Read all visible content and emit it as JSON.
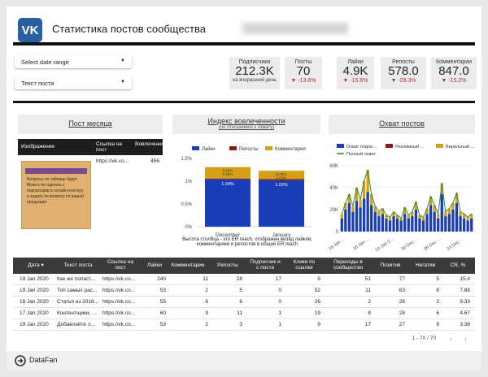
{
  "header": {
    "logo_text": "VK",
    "title": "Статистика постов сообщества"
  },
  "filters": {
    "date_range": "Select date range",
    "post_text": "Текст поста"
  },
  "kpis": [
    {
      "label": "Подписчики",
      "value": "212.3K",
      "sub": "на вчерашний день",
      "change": ""
    },
    {
      "label": "Посты",
      "value": "70",
      "sub": "",
      "change": "-13.6%"
    },
    {
      "label": "Лайки",
      "value": "4.9K",
      "sub": "",
      "change": "-15.6%"
    },
    {
      "label": "Репосты",
      "value": "578.0",
      "sub": "",
      "change": "-29.3%"
    },
    {
      "label": "Комментарии",
      "value": "847.0",
      "sub": "",
      "change": "-15.2%"
    }
  ],
  "sections": {
    "post_month": "Пост месяца",
    "engagement": "Индекс вовлеченности",
    "engagement_sub": "(по отношению к охвату)",
    "reach": "Охват постов"
  },
  "post_table": {
    "headers": [
      "Изображение",
      "Ссылка на пост",
      "Вовлеченность"
    ],
    "link": "https://vk.co...",
    "value": "456",
    "image_caption": "Вопросы по таблице будут. Можно ли сделать с подписками в онлайн-контору и задать по вопросу по вашей продукции"
  },
  "engagement_note": "Высота столбца - это ER reach, отображен вклад лайков, комментариев и репостов в общий ER reach",
  "chart_data": [
    {
      "type": "bar",
      "categories": [
        "December",
        "January"
      ],
      "series": [
        {
          "name": "Лайки",
          "values": [
            1.04,
            1.02
          ]
        },
        {
          "name": "Репосты",
          "values": [
            0.02,
            0.03
          ]
        },
        {
          "name": "Комментарии",
          "values": [
            0.25,
            0.18
          ]
        }
      ],
      "data_labels": [
        {
          "category": "December",
          "labels": [
            "1.04%",
            "0.02%",
            "0.25%"
          ]
        },
        {
          "category": "January",
          "labels": [
            "1.02%",
            "0.03%",
            "0.03%",
            "0.18%"
          ]
        }
      ],
      "yticks": [
        "0%",
        "0.5%",
        "1%",
        "1.5%"
      ],
      "ylim": [
        0,
        1.5
      ],
      "legend": "top",
      "colors": {
        "Лайки": "#1a3db8",
        "Репосты": "#8b1a1a",
        "Комментарии": "#d4a017"
      }
    },
    {
      "type": "bar",
      "title": "Охват постов",
      "legend": "top",
      "yticks": [
        "0",
        "20K",
        "40K",
        "60K"
      ],
      "ylim": [
        0,
        65000
      ],
      "xticks": [
        "19 Jan ...",
        "16 Jan ...",
        "10 Jan 2...",
        "30 Dec ...",
        "26 Dec ...",
        "23 Dec ..."
      ],
      "series": [
        {
          "name": "Охват подпи...",
          "color": "#1a3db8"
        },
        {
          "name": "Рекламный ...",
          "color": "#8b1a1a"
        },
        {
          "name": "Виральный ...",
          "color": "#d4a017"
        },
        {
          "name": "Полный охват",
          "color": "#2e8b3c"
        }
      ],
      "values": [
        {
          "sub": 12000,
          "ad": 0,
          "vir": 4000,
          "full": 16000
        },
        {
          "sub": 20000,
          "ad": 0,
          "vir": 6000,
          "full": 26000
        },
        {
          "sub": 26000,
          "ad": 0,
          "vir": 8000,
          "full": 34000
        },
        {
          "sub": 18000,
          "ad": 0,
          "vir": 5000,
          "full": 23000
        },
        {
          "sub": 28000,
          "ad": 0,
          "vir": 12000,
          "full": 40000
        },
        {
          "sub": 22000,
          "ad": 0,
          "vir": 7000,
          "full": 29000
        },
        {
          "sub": 30000,
          "ad": 0,
          "vir": 16000,
          "full": 46000
        },
        {
          "sub": 36000,
          "ad": 0,
          "vir": 20000,
          "full": 56000
        },
        {
          "sub": 24000,
          "ad": 0,
          "vir": 10000,
          "full": 34000
        },
        {
          "sub": 18000,
          "ad": 0,
          "vir": 5000,
          "full": 23000
        },
        {
          "sub": 14000,
          "ad": 0,
          "vir": 4000,
          "full": 18000
        },
        {
          "sub": 16000,
          "ad": 0,
          "vir": 5000,
          "full": 21000
        },
        {
          "sub": 12000,
          "ad": 0,
          "vir": 3000,
          "full": 15000
        },
        {
          "sub": 10000,
          "ad": 0,
          "vir": 3000,
          "full": 13000
        },
        {
          "sub": 14000,
          "ad": 0,
          "vir": 4000,
          "full": 18000
        },
        {
          "sub": 12000,
          "ad": 0,
          "vir": 3000,
          "full": 15000
        },
        {
          "sub": 10000,
          "ad": 0,
          "vir": 2000,
          "full": 12000
        },
        {
          "sub": 16000,
          "ad": 0,
          "vir": 6000,
          "full": 22000
        },
        {
          "sub": 12000,
          "ad": 0,
          "vir": 3000,
          "full": 15000
        },
        {
          "sub": 14000,
          "ad": 0,
          "vir": 4000,
          "full": 18000
        },
        {
          "sub": 20000,
          "ad": 0,
          "vir": 7000,
          "full": 27000
        },
        {
          "sub": 12000,
          "ad": 0,
          "vir": 3000,
          "full": 15000
        },
        {
          "sub": 10000,
          "ad": 0,
          "vir": 3000,
          "full": 13000
        },
        {
          "sub": 16000,
          "ad": 0,
          "vir": 5000,
          "full": 21000
        },
        {
          "sub": 24000,
          "ad": 0,
          "vir": 8000,
          "full": 32000
        },
        {
          "sub": 18000,
          "ad": 0,
          "vir": 6000,
          "full": 24000
        },
        {
          "sub": 12000,
          "ad": 0,
          "vir": 4000,
          "full": 16000
        },
        {
          "sub": 34000,
          "ad": 0,
          "vir": 10000,
          "full": 44000
        },
        {
          "sub": 14000,
          "ad": 0,
          "vir": 4000,
          "full": 18000
        },
        {
          "sub": 16000,
          "ad": 0,
          "vir": 5000,
          "full": 21000
        },
        {
          "sub": 20000,
          "ad": 0,
          "vir": 6000,
          "full": 26000
        },
        {
          "sub": 26000,
          "ad": 0,
          "vir": 9000,
          "full": 35000
        },
        {
          "sub": 14000,
          "ad": 0,
          "vir": 4000,
          "full": 18000
        },
        {
          "sub": 12000,
          "ad": 0,
          "vir": 4000,
          "full": 16000
        },
        {
          "sub": 10000,
          "ad": 0,
          "vir": 3000,
          "full": 13000
        },
        {
          "sub": 12000,
          "ad": 0,
          "vir": 4000,
          "full": 16000
        }
      ]
    }
  ],
  "data_table": {
    "headers": [
      "Дата",
      "Текст поста",
      "Ссылка на пост",
      "Лайки",
      "Комментарии",
      "Репосты",
      "Подписчик и с поста",
      "Клики по ссылке",
      "Переходы в сообщество",
      "Позитив",
      "Негатив",
      "CR, %"
    ],
    "rows": [
      [
        "19 Jan 2020",
        "Как же попаст...",
        "https://vk.co...",
        "240",
        "11",
        "28",
        "17",
        "9",
        "51",
        "77",
        "5",
        "15.4"
      ],
      [
        "19 Jan 2020",
        "Топ самых рас...",
        "https://vk.co...",
        "53",
        "2",
        "5",
        "0",
        "52",
        "11",
        "63",
        "8",
        "7.88"
      ],
      [
        "18 Jan 2020",
        "Статья из 2016...",
        "https://vk.co...",
        "55",
        "6",
        "6",
        "0",
        "26",
        "2",
        "28",
        "3",
        "9.33"
      ],
      [
        "17 Jan 2020",
        "Контентщики, ...",
        "https://vk.co...",
        "60",
        "9",
        "11",
        "1",
        "19",
        "8",
        "28",
        "6",
        "4.67"
      ],
      [
        "19 Jan 2020",
        "Добавляйте л...",
        "https://vk.co...",
        "53",
        "2",
        "3",
        "1",
        "9",
        "17",
        "27",
        "8",
        "3.38"
      ]
    ],
    "pagination": "1 - 70 / 70"
  },
  "footer": {
    "brand": "DataFan"
  }
}
